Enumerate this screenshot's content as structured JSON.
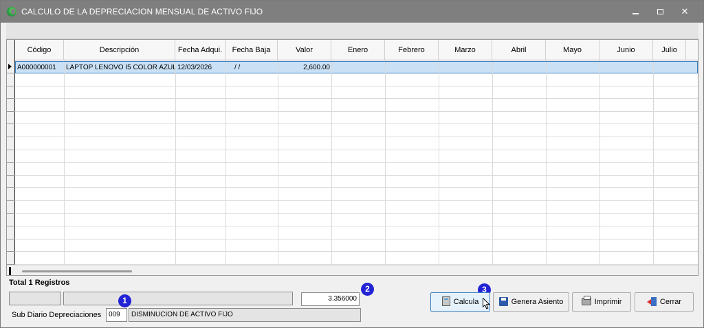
{
  "window": {
    "title": "CALCULO DE LA DEPRECIACION MENSUAL DE ACTIVO FIJO",
    "controls": {
      "minimize": "–",
      "maximize": "□",
      "close": "✕"
    }
  },
  "grid": {
    "columns": [
      "Código",
      "Descripción",
      "Fecha Adqui.",
      "Fecha Baja",
      "Valor",
      "Enero",
      "Febrero",
      "Marzo",
      "Abril",
      "Mayo",
      "Junio",
      "Julio"
    ],
    "rows": [
      {
        "codigo": "A000000001",
        "descripcion": "LAPTOP LENOVO I5 COLOR AZUL",
        "fecha_adqui": "12/03/2026",
        "fecha_baja": "/  /",
        "valor": "2,600.00",
        "enero": "",
        "febrero": "",
        "marzo": "",
        "abril": "",
        "mayo": "",
        "junio": "",
        "julio": ""
      }
    ]
  },
  "footer": {
    "total_label": "Total 1 Registros",
    "field_a": "",
    "field_b": "",
    "tipo_cambio": "3.356000",
    "sub_diario_label": "Sub Diario Depreciaciones",
    "sub_diario_code": "009",
    "sub_diario_desc": "DISMINUCION DE ACTIVO FIJO"
  },
  "badges": [
    "1",
    "2",
    "3"
  ],
  "buttons": {
    "calcula": "Calcula",
    "genera_asiento": "Genera Asiento",
    "imprimir": "Imprimir",
    "cerrar": "Cerrar"
  },
  "colors": {
    "titlebar": "#7f7f7f",
    "selected_row": "#c9e0f5",
    "badge": "#2323d6"
  }
}
